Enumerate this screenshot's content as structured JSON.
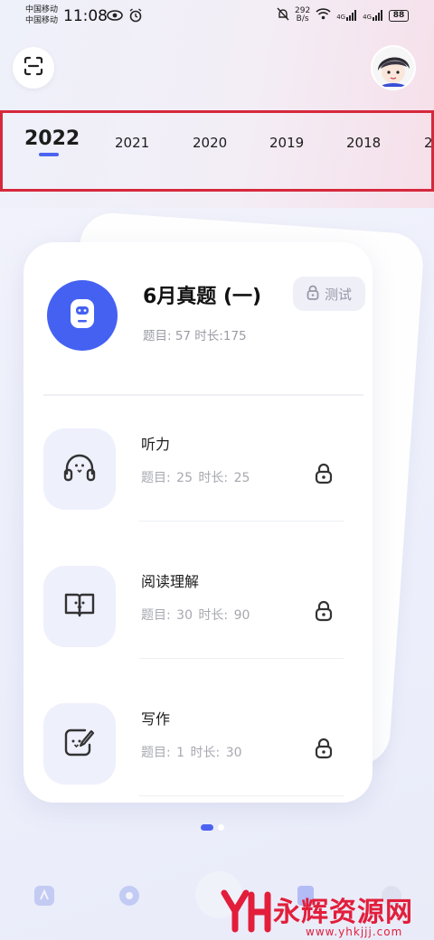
{
  "status_bar": {
    "carrier_1": "中国移动",
    "carrier_2": "中国移动",
    "time": "11:08",
    "net_speed_value": "292",
    "net_speed_unit": "B/s",
    "signal_1": "4G",
    "signal_2": "4G",
    "battery": "88"
  },
  "year_tabs": [
    {
      "label": "2022",
      "active": true
    },
    {
      "label": "2021",
      "active": false
    },
    {
      "label": "2020",
      "active": false
    },
    {
      "label": "2019",
      "active": false
    },
    {
      "label": "2018",
      "active": false
    },
    {
      "label": "2",
      "active": false
    }
  ],
  "exam": {
    "title": "6月真题 (一)",
    "meta": "题目:  57    时长:175",
    "test_button": "测试"
  },
  "sections": [
    {
      "title": "听力",
      "meta": "题目:  25    时长:  25",
      "icon": "headphones-icon"
    },
    {
      "title": "阅读理解",
      "meta": "题目:  30    时长:  90",
      "icon": "book-icon"
    },
    {
      "title": "写作",
      "meta": "题目:  1    时长:  30",
      "icon": "edit-icon"
    }
  ],
  "watermark": {
    "text": "永辉资源网",
    "url": "www.yhkjjj.com"
  },
  "colors": {
    "accent": "#4b63f0",
    "exam_icon_bg": "#4461f2",
    "highlight_border": "#d6283c",
    "watermark": "#e21e3b"
  }
}
